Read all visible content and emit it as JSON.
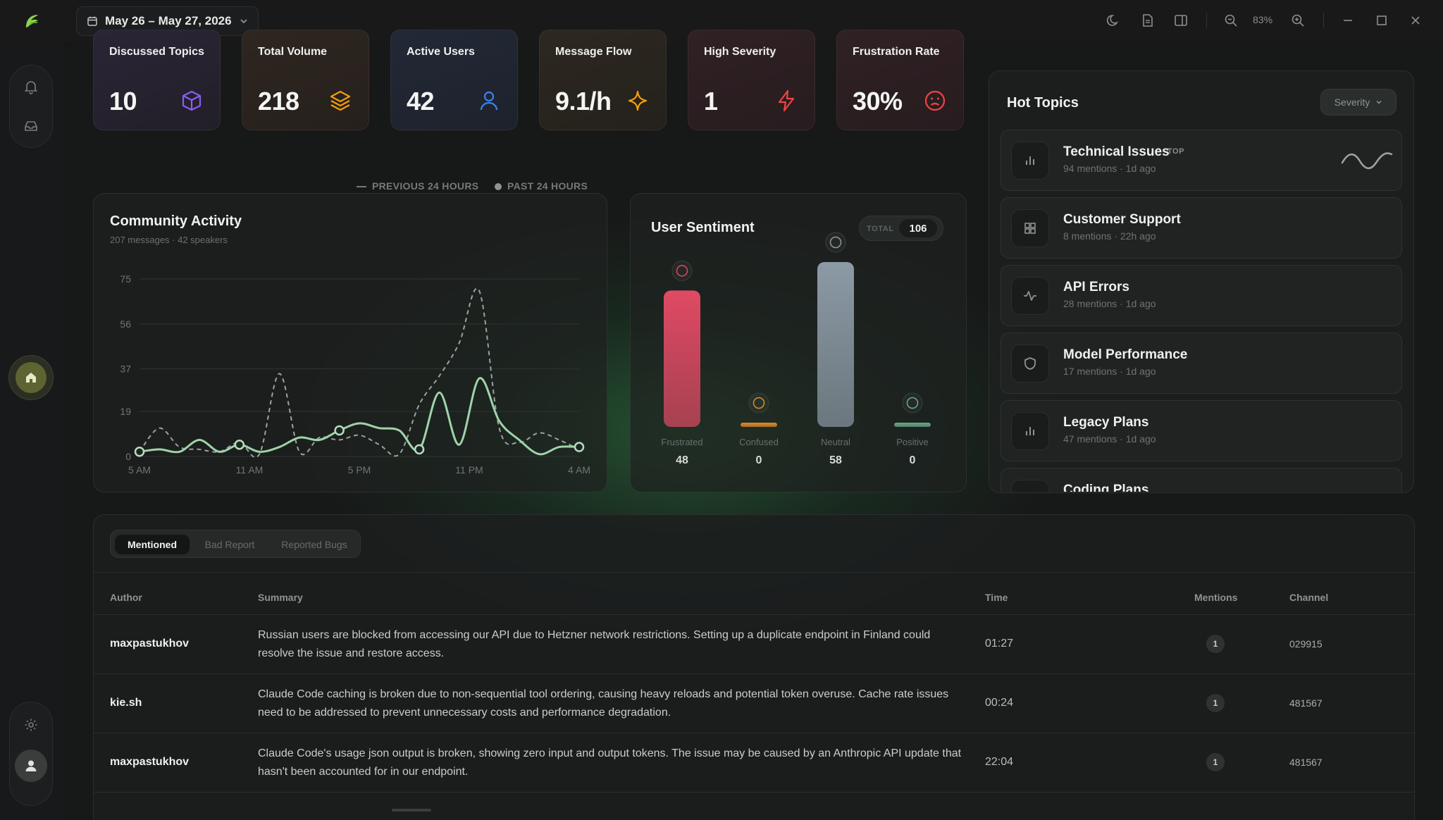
{
  "topbar": {
    "date_range": "May 26 – May 27, 2026",
    "zoom": "83%"
  },
  "stats": [
    {
      "title": "Discussed Topics",
      "value": "10",
      "icon": "cube-icon",
      "accent": "#8b5cf6"
    },
    {
      "title": "Total Volume",
      "value": "218",
      "icon": "layers-icon",
      "accent": "#f59e0b"
    },
    {
      "title": "Active Users",
      "value": "42",
      "icon": "user-icon",
      "accent": "#3b82f6"
    },
    {
      "title": "Message Flow",
      "value": "9.1/h",
      "icon": "sparkle-icon",
      "accent": "#f59e0b"
    },
    {
      "title": "High Severity",
      "value": "1",
      "icon": "bolt-icon",
      "accent": "#ef4444"
    },
    {
      "title": "Frustration Rate",
      "value": "30%",
      "icon": "frown-icon",
      "accent": "#ef4444"
    }
  ],
  "activity": {
    "title": "Community Activity",
    "subtitle": "207 messages · 42 speakers",
    "legend_prev": "PREVIOUS 24 HOURS",
    "legend_past": "PAST 24 HOURS"
  },
  "chart_data": {
    "type": "line",
    "title": "Community Activity",
    "x_ticks": [
      "5 AM",
      "11 AM",
      "5 PM",
      "11 PM",
      "4 AM"
    ],
    "y_ticks": [
      0,
      19,
      37,
      56,
      75
    ],
    "ylim": [
      0,
      75
    ],
    "grid": true,
    "legend": "top-right",
    "series": [
      {
        "name": "PREVIOUS 24 HOURS",
        "style": "dashed",
        "values": [
          2,
          12,
          4,
          3,
          2,
          6,
          1,
          35,
          2,
          8,
          7,
          9,
          5,
          1,
          22,
          34,
          48,
          70,
          12,
          6,
          10,
          7,
          3
        ]
      },
      {
        "name": "PAST 24 HOURS",
        "style": "solid",
        "values": [
          2,
          3,
          2,
          7,
          2,
          5,
          2,
          4,
          8,
          7,
          11,
          14,
          12,
          11,
          3,
          27,
          5,
          33,
          15,
          7,
          1,
          4,
          4
        ]
      }
    ]
  },
  "sentiment": {
    "title": "User Sentiment",
    "total_label": "TOTAL",
    "total_value": "106",
    "bars": [
      {
        "label": "Frustrated",
        "value": 48,
        "display": "48",
        "color": "#e04a64"
      },
      {
        "label": "Confused",
        "value": 0,
        "display": "0",
        "color": "#e08a2a"
      },
      {
        "label": "Neutral",
        "value": 58,
        "display": "58",
        "color": "#8c9aa6"
      },
      {
        "label": "Positive",
        "value": 0,
        "display": "0",
        "color": "#6aa98a"
      }
    ]
  },
  "hot_topics": {
    "title": "Hot Topics",
    "sort_label": "Severity",
    "top_badge": "TOP",
    "items": [
      {
        "name": "Technical Issues",
        "meta": "94 mentions · 1d ago",
        "icon": "bar-chart-icon"
      },
      {
        "name": "Customer Support",
        "meta": "8 mentions · 22h ago",
        "icon": "grid-icon"
      },
      {
        "name": "API Errors",
        "meta": "28 mentions · 1d ago",
        "icon": "pulse-icon"
      },
      {
        "name": "Model Performance",
        "meta": "17 mentions · 1d ago",
        "icon": "shield-icon"
      },
      {
        "name": "Legacy Plans",
        "meta": "47 mentions · 1d ago",
        "icon": "bar-chart-icon"
      },
      {
        "name": "Coding Plans",
        "meta": "",
        "icon": "grid-icon"
      }
    ]
  },
  "table": {
    "tabs": [
      "Mentioned",
      "Bad Report",
      "Reported Bugs"
    ],
    "columns": [
      "Author",
      "Summary",
      "Time",
      "Mentions",
      "Channel"
    ],
    "rows": [
      {
        "author": "maxpastukhov",
        "summary": "Russian users are blocked from accessing our API due to Hetzner network restrictions. Setting up a duplicate endpoint in Finland could resolve the issue and restore access.",
        "time": "01:27",
        "mentions": "1",
        "channel": "029915"
      },
      {
        "author": "kie.sh",
        "summary": "Claude Code caching is broken due to non-sequential tool ordering, causing heavy reloads and potential token overuse. Cache rate issues need to be addressed to prevent unnecessary costs and performance degradation.",
        "time": "00:24",
        "mentions": "1",
        "channel": "481567"
      },
      {
        "author": "maxpastukhov",
        "summary": "Claude Code's usage json output is broken, showing zero input and output tokens. The issue may be caused by an Anthropic API update that hasn't been accounted for in our endpoint.",
        "time": "22:04",
        "mentions": "1",
        "channel": "481567"
      }
    ]
  }
}
